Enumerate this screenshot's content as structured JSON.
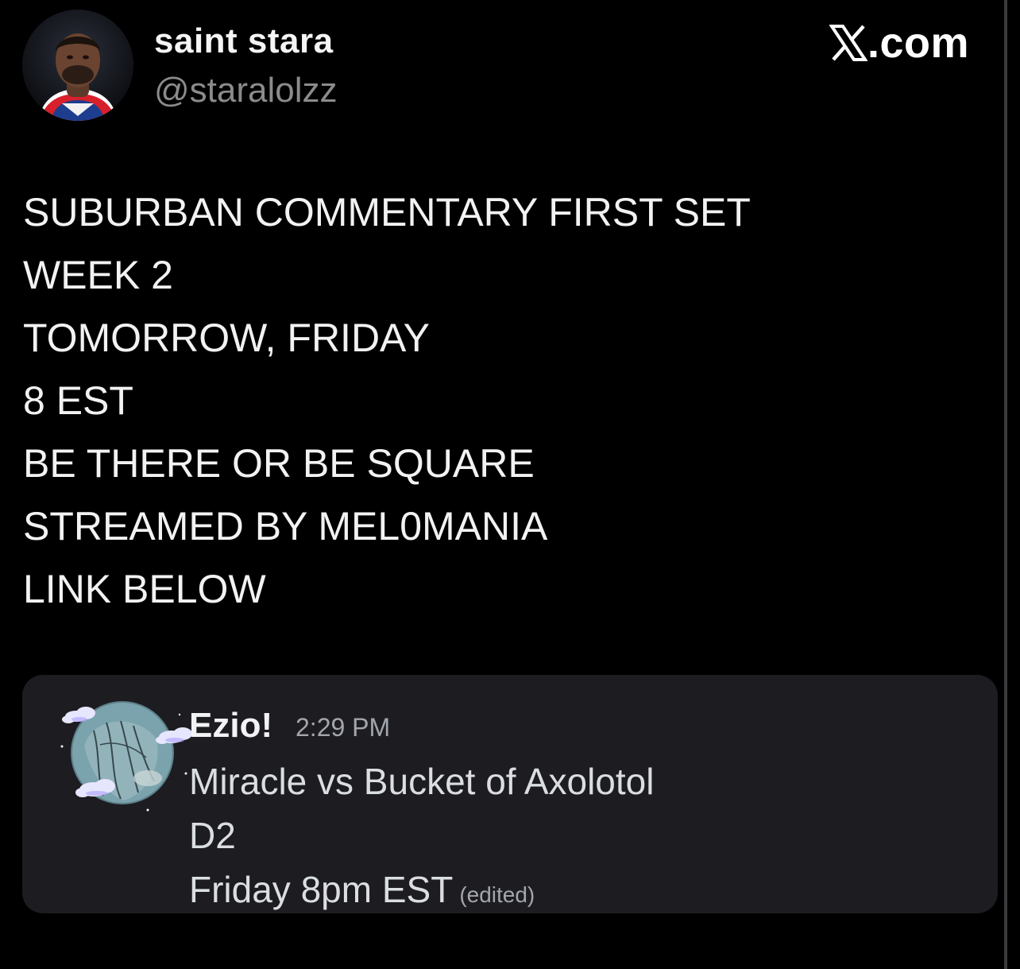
{
  "header": {
    "display_name": "saint stara",
    "handle": "@staralolzz",
    "brand_domain": ".com",
    "brand_icon": "x-logo-icon"
  },
  "tweet": {
    "lines": [
      "SUBURBAN COMMENTARY FIRST SET",
      "WEEK 2",
      "TOMORROW, FRIDAY",
      "8 EST",
      "BE THERE OR BE SQUARE",
      "STREAMED BY MEL0MANIA",
      "LINK BELOW"
    ]
  },
  "embed": {
    "author": "Ezio!",
    "time": "2:29 PM",
    "lines": [
      "Miracle vs Bucket of Axolotol",
      "D2"
    ],
    "last_line": "Friday 8pm EST",
    "edited_label": "(edited)"
  },
  "colors": {
    "background": "#000000",
    "text": "#f2f2f2",
    "handle": "#8b8b8b",
    "card_background": "#1c1c21",
    "timestamp": "#a3a6ac"
  }
}
